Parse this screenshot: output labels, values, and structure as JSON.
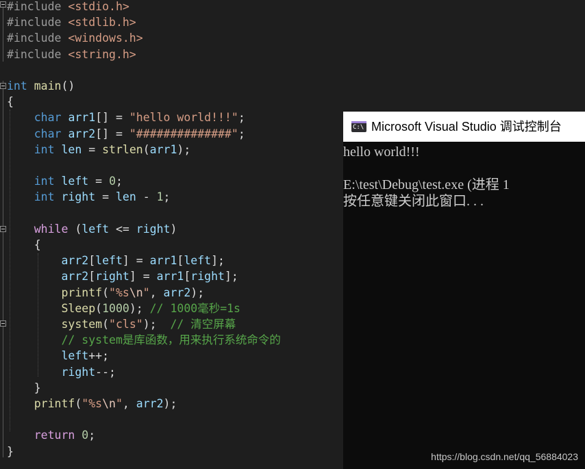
{
  "editor": {
    "colors": {
      "background": "#1e1e1e",
      "preprocessor": "#9b9b9b",
      "keyword": "#569cd6",
      "control": "#d8a0df",
      "identifier": "#9cdcfe",
      "function": "#dcdcaa",
      "string": "#d69d85",
      "escape": "#e8c9bb",
      "number": "#b5cea8",
      "comment": "#57a64a",
      "text": "#dcdcdc"
    },
    "lines": [
      [
        {
          "t": "#include ",
          "c": "preprocessor"
        },
        {
          "t": "<stdio.h>",
          "c": "string"
        }
      ],
      [
        {
          "t": "#include ",
          "c": "preprocessor"
        },
        {
          "t": "<stdlib.h>",
          "c": "string"
        }
      ],
      [
        {
          "t": "#include ",
          "c": "preprocessor"
        },
        {
          "t": "<windows.h>",
          "c": "string"
        }
      ],
      [
        {
          "t": "#include ",
          "c": "preprocessor"
        },
        {
          "t": "<string.h>",
          "c": "string"
        }
      ],
      [],
      [
        {
          "t": "int",
          "c": "keyword"
        },
        {
          "t": " ",
          "c": "text"
        },
        {
          "t": "main",
          "c": "function"
        },
        {
          "t": "()",
          "c": "text"
        }
      ],
      [
        {
          "t": "{",
          "c": "text"
        }
      ],
      [
        {
          "t": "    ",
          "c": "text"
        },
        {
          "t": "char",
          "c": "keyword"
        },
        {
          "t": " ",
          "c": "text"
        },
        {
          "t": "arr1",
          "c": "identifier"
        },
        {
          "t": "[] = ",
          "c": "text"
        },
        {
          "t": "\"hello world!!!\"",
          "c": "string"
        },
        {
          "t": ";",
          "c": "text"
        }
      ],
      [
        {
          "t": "    ",
          "c": "text"
        },
        {
          "t": "char",
          "c": "keyword"
        },
        {
          "t": " ",
          "c": "text"
        },
        {
          "t": "arr2",
          "c": "identifier"
        },
        {
          "t": "[] = ",
          "c": "text"
        },
        {
          "t": "\"##############\"",
          "c": "string"
        },
        {
          "t": ";",
          "c": "text"
        }
      ],
      [
        {
          "t": "    ",
          "c": "text"
        },
        {
          "t": "int",
          "c": "keyword"
        },
        {
          "t": " ",
          "c": "text"
        },
        {
          "t": "len",
          "c": "identifier"
        },
        {
          "t": " = ",
          "c": "text"
        },
        {
          "t": "strlen",
          "c": "function"
        },
        {
          "t": "(",
          "c": "text"
        },
        {
          "t": "arr1",
          "c": "identifier"
        },
        {
          "t": ");",
          "c": "text"
        }
      ],
      [],
      [
        {
          "t": "    ",
          "c": "text"
        },
        {
          "t": "int",
          "c": "keyword"
        },
        {
          "t": " ",
          "c": "text"
        },
        {
          "t": "left",
          "c": "identifier"
        },
        {
          "t": " = ",
          "c": "text"
        },
        {
          "t": "0",
          "c": "number"
        },
        {
          "t": ";",
          "c": "text"
        }
      ],
      [
        {
          "t": "    ",
          "c": "text"
        },
        {
          "t": "int",
          "c": "keyword"
        },
        {
          "t": " ",
          "c": "text"
        },
        {
          "t": "right",
          "c": "identifier"
        },
        {
          "t": " = ",
          "c": "text"
        },
        {
          "t": "len",
          "c": "identifier"
        },
        {
          "t": " - ",
          "c": "text"
        },
        {
          "t": "1",
          "c": "number"
        },
        {
          "t": ";",
          "c": "text"
        }
      ],
      [],
      [
        {
          "t": "    ",
          "c": "text"
        },
        {
          "t": "while",
          "c": "control"
        },
        {
          "t": " (",
          "c": "text"
        },
        {
          "t": "left",
          "c": "identifier"
        },
        {
          "t": " <= ",
          "c": "text"
        },
        {
          "t": "right",
          "c": "identifier"
        },
        {
          "t": ")",
          "c": "text"
        }
      ],
      [
        {
          "t": "    {",
          "c": "text"
        }
      ],
      [
        {
          "t": "        ",
          "c": "text"
        },
        {
          "t": "arr2",
          "c": "identifier"
        },
        {
          "t": "[",
          "c": "text"
        },
        {
          "t": "left",
          "c": "identifier"
        },
        {
          "t": "] = ",
          "c": "text"
        },
        {
          "t": "arr1",
          "c": "identifier"
        },
        {
          "t": "[",
          "c": "text"
        },
        {
          "t": "left",
          "c": "identifier"
        },
        {
          "t": "];",
          "c": "text"
        }
      ],
      [
        {
          "t": "        ",
          "c": "text"
        },
        {
          "t": "arr2",
          "c": "identifier"
        },
        {
          "t": "[",
          "c": "text"
        },
        {
          "t": "right",
          "c": "identifier"
        },
        {
          "t": "] = ",
          "c": "text"
        },
        {
          "t": "arr1",
          "c": "identifier"
        },
        {
          "t": "[",
          "c": "text"
        },
        {
          "t": "right",
          "c": "identifier"
        },
        {
          "t": "];",
          "c": "text"
        }
      ],
      [
        {
          "t": "        ",
          "c": "text"
        },
        {
          "t": "printf",
          "c": "function"
        },
        {
          "t": "(",
          "c": "text"
        },
        {
          "t": "\"%s",
          "c": "string"
        },
        {
          "t": "\\n",
          "c": "escape"
        },
        {
          "t": "\"",
          "c": "string"
        },
        {
          "t": ", ",
          "c": "text"
        },
        {
          "t": "arr2",
          "c": "identifier"
        },
        {
          "t": ");",
          "c": "text"
        }
      ],
      [
        {
          "t": "        ",
          "c": "text"
        },
        {
          "t": "Sleep",
          "c": "function"
        },
        {
          "t": "(",
          "c": "text"
        },
        {
          "t": "1000",
          "c": "number"
        },
        {
          "t": "); ",
          "c": "text"
        },
        {
          "t": "// 1000毫秒=1s",
          "c": "comment"
        }
      ],
      [
        {
          "t": "        ",
          "c": "text"
        },
        {
          "t": "system",
          "c": "function"
        },
        {
          "t": "(",
          "c": "text"
        },
        {
          "t": "\"cls\"",
          "c": "string"
        },
        {
          "t": ");  ",
          "c": "text"
        },
        {
          "t": "// 清空屏幕",
          "c": "comment"
        }
      ],
      [
        {
          "t": "        ",
          "c": "text"
        },
        {
          "t": "// system是库函数，用来执行系统命令的",
          "c": "comment"
        }
      ],
      [
        {
          "t": "        ",
          "c": "text"
        },
        {
          "t": "left",
          "c": "identifier"
        },
        {
          "t": "++;",
          "c": "text"
        }
      ],
      [
        {
          "t": "        ",
          "c": "text"
        },
        {
          "t": "right",
          "c": "identifier"
        },
        {
          "t": "--;",
          "c": "text"
        }
      ],
      [
        {
          "t": "    }",
          "c": "text"
        }
      ],
      [
        {
          "t": "    ",
          "c": "text"
        },
        {
          "t": "printf",
          "c": "function"
        },
        {
          "t": "(",
          "c": "text"
        },
        {
          "t": "\"%s",
          "c": "string"
        },
        {
          "t": "\\n",
          "c": "escape"
        },
        {
          "t": "\"",
          "c": "string"
        },
        {
          "t": ", ",
          "c": "text"
        },
        {
          "t": "arr2",
          "c": "identifier"
        },
        {
          "t": ");",
          "c": "text"
        }
      ],
      [],
      [
        {
          "t": "    ",
          "c": "text"
        },
        {
          "t": "return",
          "c": "control"
        },
        {
          "t": " ",
          "c": "text"
        },
        {
          "t": "0",
          "c": "number"
        },
        {
          "t": ";",
          "c": "text"
        }
      ],
      [
        {
          "t": "}",
          "c": "text"
        }
      ]
    ]
  },
  "console": {
    "icon": "console-app-icon",
    "icon_glyph": "C:\\",
    "title": "Microsoft Visual Studio 调试控制台",
    "output": [
      "hello world!!!",
      "",
      "E:\\test\\Debug\\test.exe (进程 1",
      "按任意键关闭此窗口. . ."
    ]
  },
  "watermark": "https://blog.csdn.net/qq_56884023"
}
